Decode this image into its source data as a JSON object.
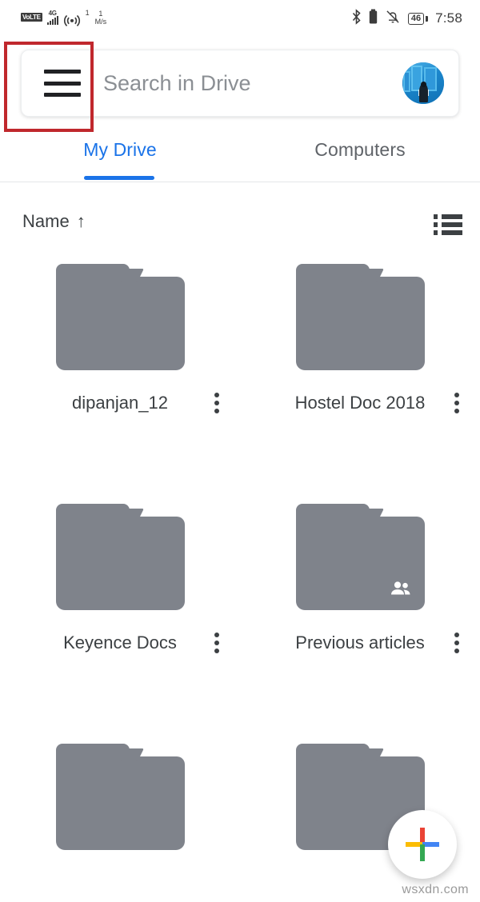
{
  "statusbar": {
    "volte": "VoLTE",
    "network_type": "4G",
    "signal_sup": "1",
    "net_speed_value": "1",
    "net_speed_unit": "M/s",
    "bluetooth_icon": "bluetooth-icon",
    "battery_status_icon": "battery-icon",
    "mute_icon": "bell-off-icon",
    "battery_percent": "46",
    "clock": "7:58"
  },
  "search": {
    "menu_icon": "hamburger-menu-icon",
    "placeholder": "Search in Drive",
    "avatar_label": "account-avatar"
  },
  "annotation": {
    "color": "#c0282d",
    "target": "hamburger-menu-icon"
  },
  "tabs": {
    "items": [
      {
        "label": "My Drive",
        "active": true
      },
      {
        "label": "Computers",
        "active": false
      }
    ],
    "active_color": "#1a73e8",
    "inactive_color": "#5f6368"
  },
  "sort": {
    "label": "Name",
    "direction_icon": "arrow-up-icon",
    "direction_glyph": "↑",
    "view_toggle_icon": "list-view-icon"
  },
  "files": [
    {
      "name": "dipanjan_12",
      "type": "folder",
      "shared": false
    },
    {
      "name": "Hostel Doc 2018",
      "type": "folder",
      "shared": false
    },
    {
      "name": "Keyence Docs",
      "type": "folder",
      "shared": false
    },
    {
      "name": "Previous articles",
      "type": "folder",
      "shared": true
    },
    {
      "name": "",
      "type": "folder",
      "shared": false
    },
    {
      "name": "",
      "type": "folder",
      "shared": false
    }
  ],
  "folder_color": "#7f838b",
  "fab": {
    "label": "create-new-button",
    "icon": "google-plus-icon",
    "colors": {
      "top": "#ea4335",
      "right": "#4285f4",
      "bottom": "#34a853",
      "left": "#fbbc04"
    }
  },
  "watermark": "wsxdn.com"
}
